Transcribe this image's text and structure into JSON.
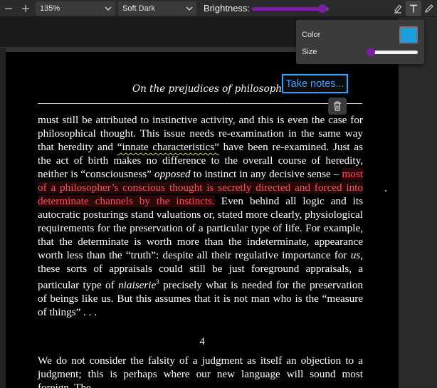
{
  "toolbar": {
    "zoom_value": "135%",
    "theme_value": "Soft Dark",
    "brightness_label": "Brightness:",
    "brightness_level": 0.92
  },
  "page": {
    "running_head": "On the prejudices of philosophers",
    "para1_a": "must still be attributed to instinctive activity, and this is even the case for philosophical thought. This issue needs re-examination in the same way that heredity and ",
    "para1_underlined": "“innate characteristics”",
    "para1_b": " have been re-examined. Just as the act of birth makes no difference to the overall course of heredity, neither is “consciousness” ",
    "para1_italic": "opposed",
    "para1_c": " to instinct in any decisive sense – ",
    "para1_highlight": "most of a philosopher’s conscious thought is secretly directed and forced into determinate channels by the instincts.",
    "para1_d": " Even behind all logic and its autocratic posturings stand valuations or, stated more clearly, physiological requirements for the preservation of a particular type of life. For example, that the determinate is worth more than the indeterminate, appearance worth less than the “truth”: despite all their regulative importance for ",
    "para1_us": "us",
    "para1_e": ", these sorts of appraisals could still be just foreground appraisals, a particular type of ",
    "para1_niaiserie": "niaiserie",
    "para1_fn": "3",
    "para1_f": " precisely what is needed for the preservation of beings like us. But this assumes that it is not man who is the “measure of things” . . .",
    "section_number": "4",
    "para2": "We do not consider the falsity of a judgment as itself an objection to a judgment; this is perhaps where our new language will sound most foreign. The"
  },
  "note": {
    "take_notes_label": "Take notes..."
  },
  "popover": {
    "color_label": "Color",
    "size_label": "Size",
    "color_value": "#1a9fdf",
    "size_level": 0.05
  },
  "colors": {
    "accent_purple": "#7b1fa2",
    "highlight_red": "#ff4d5e",
    "note_blue": "#3aa0ff"
  },
  "icons": {
    "zoom_out": "minus-icon",
    "zoom_in": "plus-icon",
    "highlighter": "highlighter-icon",
    "text_tool": "text-tool-icon",
    "pen": "pen-icon",
    "delete": "trash-icon"
  }
}
